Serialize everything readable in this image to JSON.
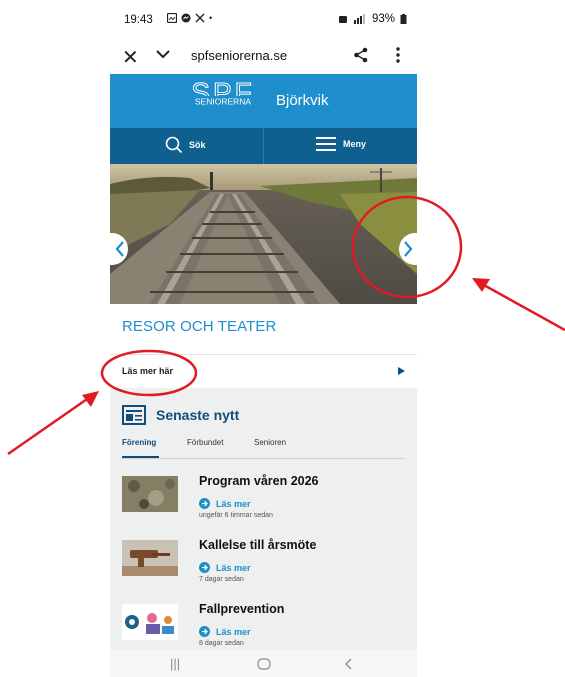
{
  "status_bar": {
    "time": "19:43",
    "battery_pct": "93%"
  },
  "browser": {
    "url": "spfseniorerna.se"
  },
  "header": {
    "logo_text": "SENIORERNA",
    "local_name": "Björkvik"
  },
  "nav": {
    "search_label": "Sök",
    "menu_label": "Meny"
  },
  "hero": {
    "title": "RESOR OCH TEATER",
    "read_more": "Läs mer här"
  },
  "news": {
    "heading": "Senaste nytt",
    "tabs": [
      "Förening",
      "Förbundet",
      "Senioren"
    ],
    "items": [
      {
        "title": "Program våren 2026",
        "link": "Läs mer",
        "ago": "ungefär 6 timmar sedan"
      },
      {
        "title": "Kallelse till årsmöte",
        "link": "Läs mer",
        "ago": "7 dagar sedan"
      },
      {
        "title": "Fallprevention",
        "link": "Läs mer",
        "ago": "8 dagar sedan"
      }
    ]
  },
  "colors": {
    "brand_blue": "#1e8fcc",
    "nav_dark": "#0f5f8f",
    "annotation_red": "#e01b24"
  }
}
